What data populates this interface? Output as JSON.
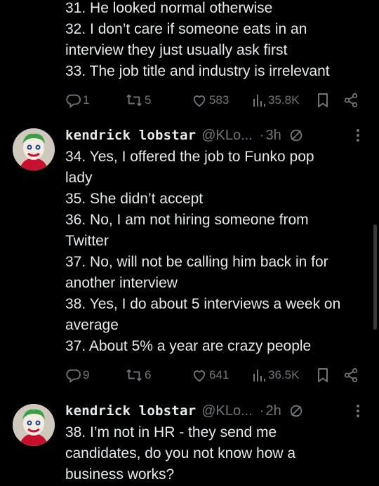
{
  "tweet_top": {
    "lines": [
      "31. He looked normal otherwise",
      "32. I don’t care if someone eats in an",
      "interview they just usually ask first",
      "33. The job title and industry is irrelevant"
    ],
    "actions": {
      "replies": "1",
      "reposts": "5",
      "likes": "583",
      "views": "35.8K"
    }
  },
  "tweet_middle": {
    "display_name": "kendrick lobstar",
    "handle": "@KLo...",
    "separator": "·",
    "time": "3h",
    "lines": [
      "34. Yes, I offered the job to Funko pop",
      "lady",
      "35. She didn’t accept",
      "36. No, I am not hiring someone from",
      "Twitter",
      "37. No, will not be calling him back in for",
      "another interview",
      "38. Yes, I do about 5 interviews a week on",
      "average",
      "37. About 5% a year are crazy people"
    ],
    "actions": {
      "replies": "9",
      "reposts": "6",
      "likes": "641",
      "views": "36.5K"
    }
  },
  "tweet_bottom": {
    "display_name": "kendrick lobstar",
    "handle": "@KLo...",
    "separator": "·",
    "time": "2h",
    "lines": [
      "38. I’m not in HR - they send me",
      "candidates, do you not know how a",
      "business works?"
    ]
  },
  "icons": {
    "reply": "reply-icon",
    "repost": "repost-icon",
    "like": "heart-icon",
    "views": "views-icon",
    "bookmark": "bookmark-icon",
    "share": "share-icon",
    "edited": "edit-slash-icon",
    "more": "more-dots-icon"
  },
  "colors": {
    "background": "#000000",
    "text": "#e7e9ea",
    "muted": "#71767b"
  }
}
